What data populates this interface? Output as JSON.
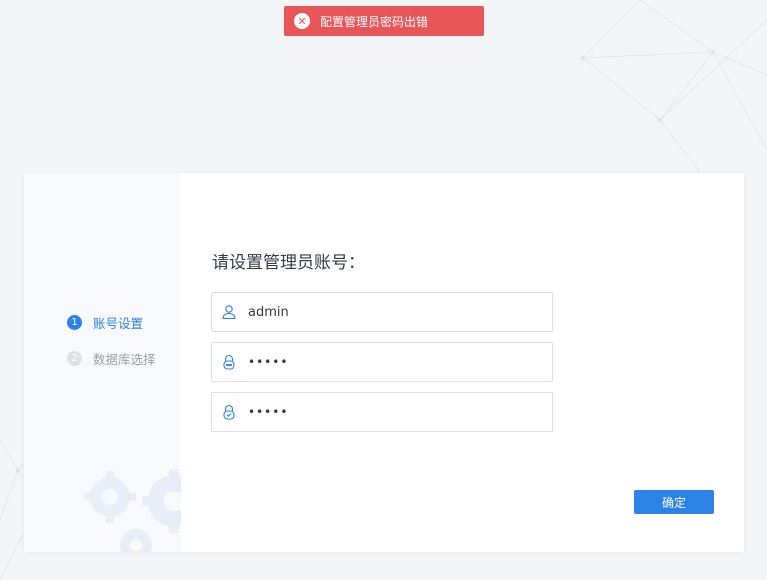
{
  "toast": {
    "message": "配置管理员密码出错",
    "icon": "close-circle-icon",
    "color": "#e8565a"
  },
  "steps": [
    {
      "number": "1",
      "label": "账号设置",
      "state": "active"
    },
    {
      "number": "2",
      "label": "数据库选择",
      "state": "inactive"
    }
  ],
  "form": {
    "title": "请设置管理员账号：",
    "username": {
      "value": "admin",
      "icon": "user-icon"
    },
    "password": {
      "value": "•••••",
      "icon": "lock-icon"
    },
    "confirm_password": {
      "value": "•••••",
      "icon": "lock-check-icon"
    },
    "confirm_label": "确定"
  },
  "colors": {
    "accent": "#2d82e8",
    "error": "#e8565a",
    "background": "#f3f4f7"
  }
}
